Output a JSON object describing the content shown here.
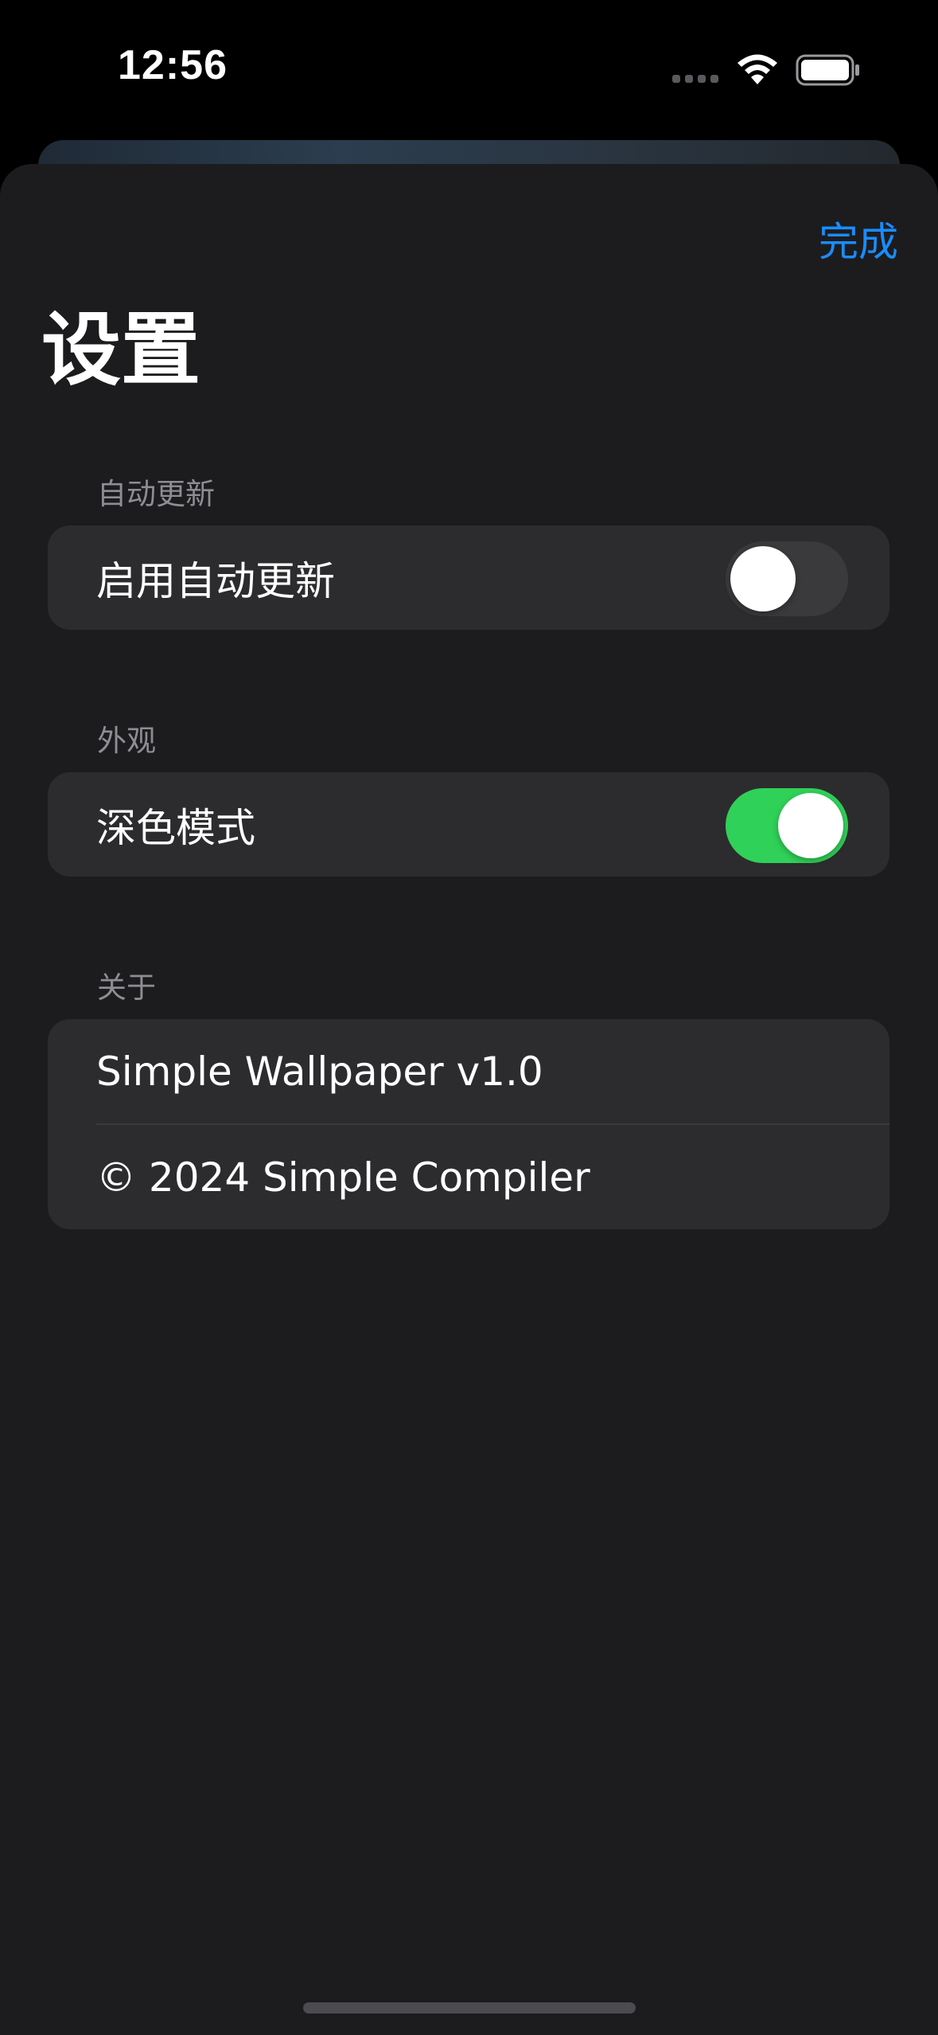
{
  "status_bar": {
    "time": "12:56",
    "icons": [
      "signal-dots-icon",
      "wifi-icon",
      "battery-icon"
    ]
  },
  "sheet": {
    "done_label": "完成",
    "title": "设置",
    "sections": [
      {
        "header": "自动更新",
        "rows": [
          {
            "label": "启用自动更新",
            "toggle": false
          }
        ]
      },
      {
        "header": "外观",
        "rows": [
          {
            "label": "深色模式",
            "toggle": true
          }
        ]
      },
      {
        "header": "关于",
        "rows": [
          {
            "label": "Simple Wallpaper v1.0"
          },
          {
            "label": "© 2024 Simple Compiler"
          }
        ]
      }
    ]
  },
  "colors": {
    "accent": "#1a8cff",
    "toggle_on": "#30d158",
    "toggle_off": "#3a3a3c",
    "sheet_background": "#1c1c1e",
    "group_background": "#2c2c2e"
  }
}
